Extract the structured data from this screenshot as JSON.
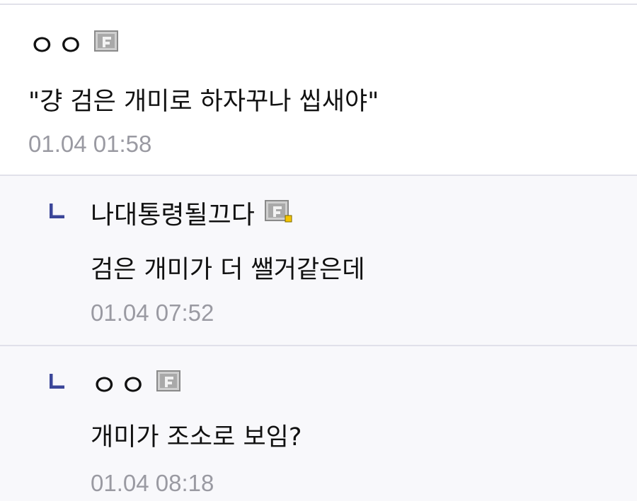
{
  "comments": [
    {
      "author": "ㅇㅇ",
      "author_icon": "gallog-icon",
      "text": "\"걍 검은 개미로 하자꾸나 씹새야\"",
      "time": "01.04 01:58",
      "is_reply": false
    },
    {
      "author": "나대통령될끄다",
      "author_icon": "gallog-fixed-icon",
      "text": "검은 개미가 더 쌜거같은데",
      "time": "01.04 07:52",
      "is_reply": true
    },
    {
      "author": "ㅇㅇ",
      "author_icon": "gallog-icon",
      "text": "개미가 조소로 보임?",
      "time": "01.04 08:18",
      "is_reply": true
    }
  ],
  "colors": {
    "reply_marker": "#3b4699",
    "timestamp": "#9a9aa2",
    "reply_background": "#f8f8fb",
    "divider": "#e1e1ea",
    "fixed_badge": "#f5c400"
  }
}
